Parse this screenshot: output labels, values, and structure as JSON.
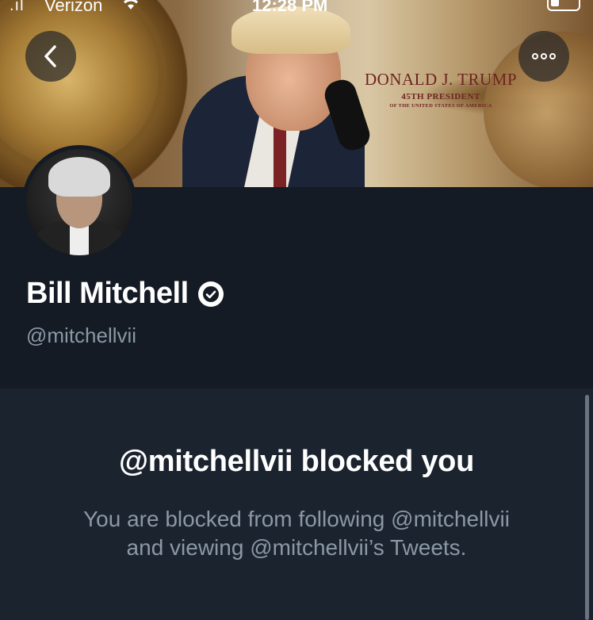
{
  "status_bar": {
    "carrier": "Verizon",
    "time": "12:28 PM"
  },
  "banner": {
    "name": "DONALD J. TRUMP",
    "subtitle": "45TH PRESIDENT",
    "subtitle2": "OF THE UNITED STATES OF AMERICA"
  },
  "profile": {
    "display_name": "Bill Mitchell",
    "handle": "@mitchellvii"
  },
  "blocked": {
    "title": "@mitchellvii blocked you",
    "message": "You are blocked from following @mitchellvii and viewing @mitchellvii’s Tweets."
  },
  "icons": {
    "back": "chevron-left-icon",
    "more": "more-dots-icon",
    "verified": "verified-badge-icon"
  },
  "colors": {
    "background": "#141b24",
    "panel": "#1b232e",
    "secondary_text": "#8b98a5"
  }
}
